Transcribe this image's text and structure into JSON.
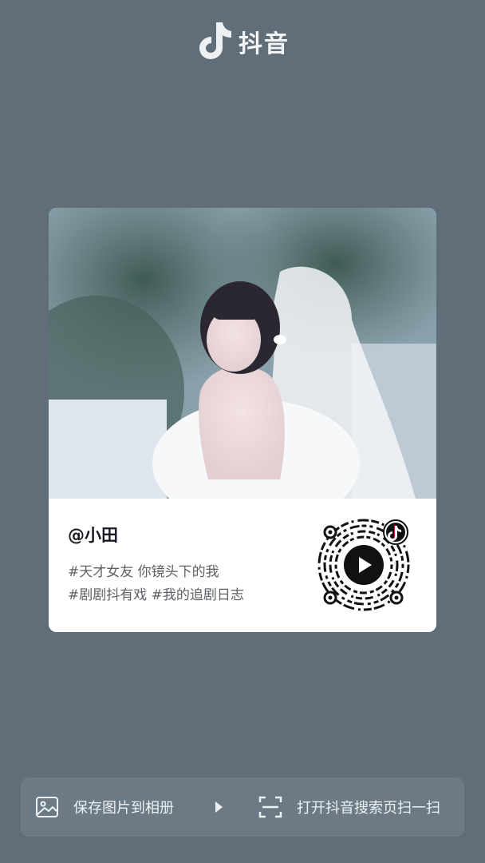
{
  "brand": {
    "name": "抖音",
    "icon": "douyin-note-icon"
  },
  "card": {
    "username": "@小田",
    "tag_lines": [
      "#天才女友 你镜头下的我",
      "#剧剧抖有戏 #我的追剧日志"
    ],
    "photo": "bride-photo",
    "qr_icon": "qr-code"
  },
  "bottom_bar": {
    "save_label": "保存图片到相册",
    "save_icon": "image-icon",
    "scan_label": "打开抖音搜索页扫一扫",
    "scan_icon": "scan-icon"
  },
  "colors": {
    "background": "#5f6e79",
    "bar": "#6b7a85",
    "card": "#ffffff"
  }
}
